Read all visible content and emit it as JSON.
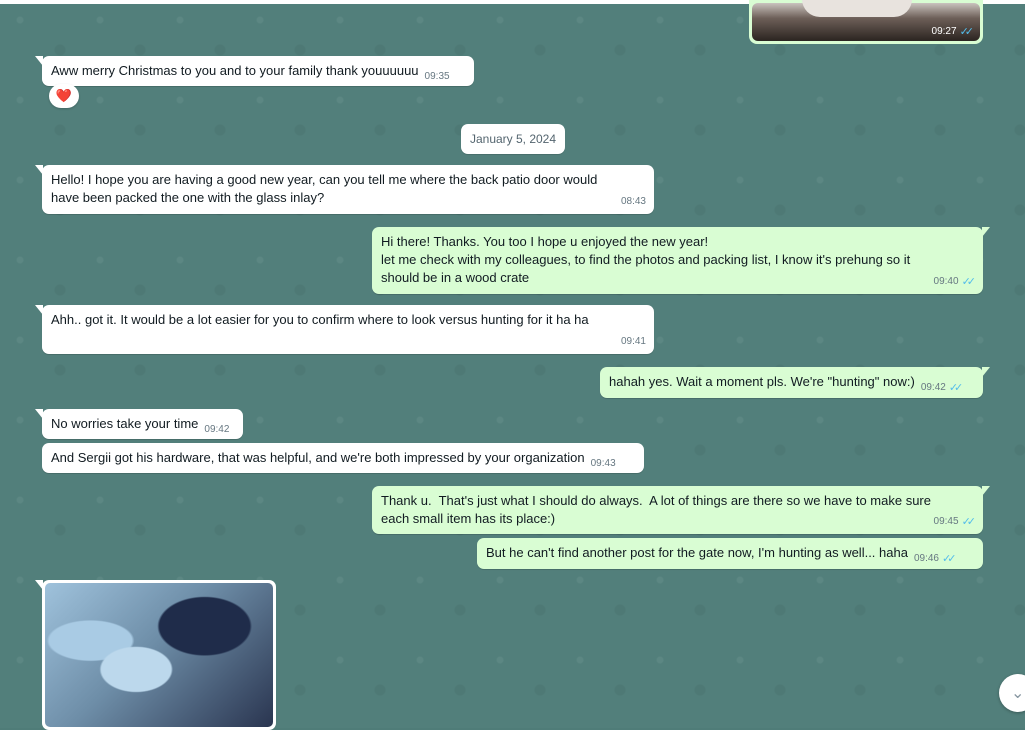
{
  "messages": [
    {
      "text": "Aww merry Christmas to you and to your family thank youuuuuu",
      "time": "09:35",
      "reaction": "❤️"
    },
    {
      "text": "Hello! I hope you are having a good new year, can you tell me where the back patio door would\nhave been packed the one with the glass inlay?",
      "time": "08:43"
    },
    {
      "text": "Hi there! Thanks. You too I hope u enjoyed the new year!\nlet me check with my colleagues, to find the photos and packing list, I know it's prehung so it\nshould be in a wood crate",
      "time": "09:40"
    },
    {
      "text": "Ahh.. got it. It would be a lot easier for you to confirm where to look versus hunting for it ha ha",
      "time": "09:41"
    },
    {
      "text": "hahah yes. Wait a moment pls. We're \"hunting\" now:)",
      "time": "09:42"
    },
    {
      "text": "No worries take your time",
      "time": "09:42"
    },
    {
      "text": "And Sergii got his hardware, that was helpful, and we're both impressed by your organization",
      "time": "09:43"
    },
    {
      "text": "Thank u.  That's just what I should do always.  A lot of things are there so we have to make sure\neach small item has its place:)",
      "time": "09:45"
    },
    {
      "text": "But he can't find another post for the gate now, I'm hunting as well... haha",
      "time": "09:46"
    }
  ],
  "top_image": {
    "time": "09:27"
  },
  "date_separator": "January 5, 2024",
  "icons": {
    "read_receipt": "double-check-icon",
    "scroll": "chevron-down-icon",
    "reaction": "heart-icon"
  },
  "colors": {
    "incoming": "#ffffff",
    "outgoing": "#d9fdd3",
    "ticks": "#53bdeb",
    "background": "#527f7b"
  }
}
